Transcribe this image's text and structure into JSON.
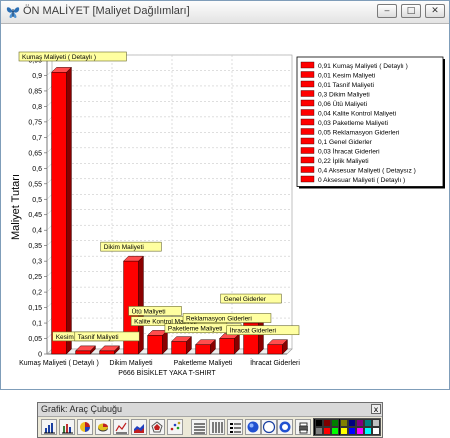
{
  "window": {
    "title": "ÖN MALİYET [Maliyet Dağılımları]",
    "controls": {
      "minimize": "‒",
      "maximize": "□",
      "close": "✕"
    }
  },
  "chart_data": {
    "type": "bar",
    "title": "",
    "xlabel": "P666 BİSİKLET YAKA T-SHIRT",
    "ylabel": "Maliyet Tutarı",
    "ylim": [
      0,
      0.95
    ],
    "yticks": [
      0,
      0.05,
      0.1,
      0.15,
      0.2,
      0.25,
      0.3,
      0.35,
      0.4,
      0.45,
      0.5,
      0.55,
      0.6,
      0.65,
      0.7,
      0.75,
      0.8,
      0.85,
      0.9,
      0.95
    ],
    "ytick_labels": [
      "0",
      "0,05",
      "0,1",
      "0,15",
      "0,2",
      "0,25",
      "0,3",
      "0,35",
      "0,4",
      "0,45",
      "0,5",
      "0,55",
      "0,6",
      "0,65",
      "0,7",
      "0,75",
      "0,8",
      "0,85",
      "0,9",
      "0,95"
    ],
    "categories": [
      "Kumaş Maliyeti ( Detaylı )",
      "Kesim Maliyeti",
      "Tasnif Maliyeti",
      "Dikim Maliyeti",
      "Ütü Maliyeti",
      "Kalite Kontrol Maliyeti",
      "Paketleme Maliyeti",
      "Reklamasyon Giderleri",
      "Genel Giderler",
      "İhracat Giderleri"
    ],
    "values": [
      0.91,
      0.01,
      0.01,
      0.3,
      0.06,
      0.04,
      0.03,
      0.05,
      0.1,
      0.03
    ],
    "xtick_labels": [
      "Kumaş Maliyeti ( Detaylı )",
      "Dikim Maliyeti",
      "Paketleme Maliyeti",
      "İhracat Giderleri"
    ],
    "data_labels": [
      "Kumaş Maliyeti ( Detaylı )",
      "Kesim Maliyeti",
      "Tasnif Maliyeti",
      "Dikim Maliyeti",
      "Ütü Maliyeti",
      "Kalite Kontrol Maliyeti",
      "Paketleme Maliyeti",
      "Reklamasyon Giderleri",
      "Genel Giderler",
      "İhracat Giderleri"
    ],
    "legend": [
      "0,91 Kumaş Maliyeti ( Detaylı )",
      "0,01 Kesim Maliyeti",
      "0,01 Tasnif Maliyeti",
      "0,3 Dikim Maliyeti",
      "0,06 Ütü Maliyeti",
      "0,04 Kalite Kontrol Maliyeti",
      "0,03 Paketleme Maliyeti",
      "0,05 Reklamasyon Giderleri",
      "0,1 Genel Giderler",
      "0,03 İhracat Giderleri",
      "0,22 İplik Maliyeti",
      "0,4 Aksesuar Maliyeti ( Detaysız )",
      "0 Aksesuar Maliyeti ( Detaylı )"
    ],
    "legend_position": "top-right",
    "grid": true,
    "bar_color": "#ff0000"
  },
  "toolbar": {
    "title": "Grafik: Araç Çubuğu",
    "close": "x",
    "buttons": [
      "bar-chart-icon",
      "bar-chart-3d-icon",
      "pie-chart-icon",
      "pie-chart-3d-icon",
      "line-chart-icon",
      "area-chart-icon",
      "radar-chart-icon",
      "scatter-chart-icon",
      "grid-lines-icon",
      "grid-horizontal-icon",
      "legend-icon",
      "font-icon",
      "color-icon",
      "zoom-icon",
      "print-icon"
    ],
    "palette": [
      "#000000",
      "#800000",
      "#008000",
      "#808000",
      "#000080",
      "#800080",
      "#008080",
      "#c0c0c0",
      "#808080",
      "#ff0000",
      "#00ff00",
      "#ffff00",
      "#0000ff",
      "#ff00ff",
      "#00ffff",
      "#ffffff"
    ]
  }
}
